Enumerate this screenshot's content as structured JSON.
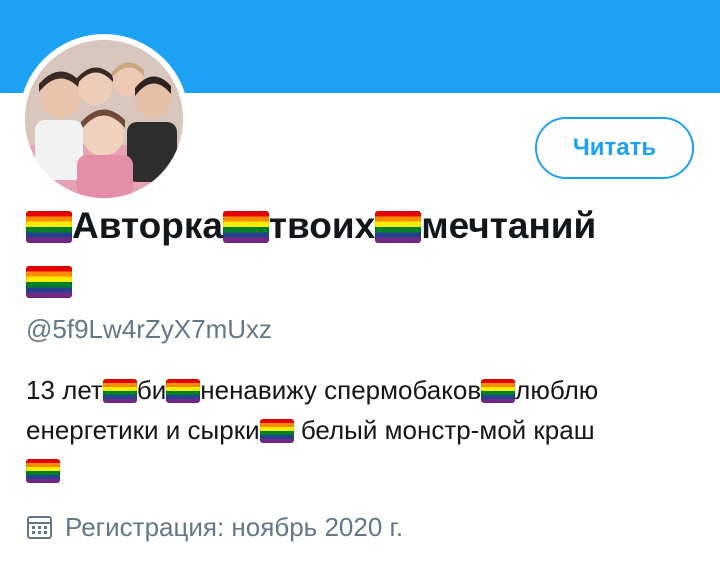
{
  "profile": {
    "display_name_parts": [
      "Авторка",
      "твоих",
      "мечтаний"
    ],
    "handle": "@5f9Lw4rZyX7mUxz",
    "follow_label": "Читать",
    "bio_line1": [
      "13 лет",
      "би",
      "ненавижу спермобаков",
      "люблю"
    ],
    "bio_line2": [
      "енергетики и сырки",
      " белый монстр-мой краш"
    ],
    "joined_text": "Регистрация: ноябрь 2020 г."
  },
  "icons": {
    "flag": "rainbow-flag-icon",
    "calendar": "calendar-icon"
  },
  "colors": {
    "banner": "#1da1f2",
    "accent": "#1da1f2",
    "secondary_text": "#657786",
    "primary_text": "#14171a"
  }
}
